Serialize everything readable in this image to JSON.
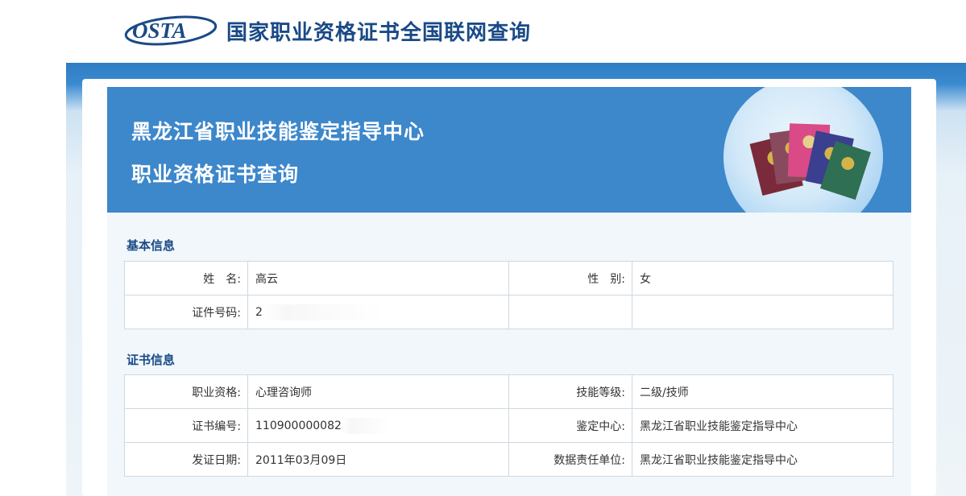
{
  "header": {
    "logo_text": "OSTA",
    "site_title": "国家职业资格证书全国联网查询"
  },
  "banner": {
    "title_line1": "黑龙江省职业技能鉴定指导中心",
    "title_line2": "职业资格证书查询"
  },
  "basic_info": {
    "section_title": "基本信息",
    "rows": [
      {
        "label1": "姓　名:",
        "value1": "高云",
        "label2": "性　别:",
        "value2": "女"
      },
      {
        "label1": "证件号码:",
        "value1": "2",
        "label2": "",
        "value2": ""
      }
    ]
  },
  "cert_info": {
    "section_title": "证书信息",
    "rows": [
      {
        "label1": "职业资格:",
        "value1": "心理咨询师",
        "label2": "技能等级:",
        "value2": "二级/技师"
      },
      {
        "label1": "证书编号:",
        "value1": "110900000082",
        "label2": "鉴定中心:",
        "value2": "黑龙江省职业技能鉴定指导中心"
      },
      {
        "label1": "发证日期:",
        "value1": "2011年03月09日",
        "label2": "数据责任单位:",
        "value2": "黑龙江省职业技能鉴定指导中心"
      }
    ]
  },
  "icons": {
    "logo": "osta-logo",
    "banner_art": "certificate-books-globe-illustration"
  },
  "colors": {
    "brand_blue": "#1a4a86",
    "banner_blue": "#3d87cb",
    "band_blue": "#2f7dc2",
    "content_bg": "#f1f7fb"
  }
}
